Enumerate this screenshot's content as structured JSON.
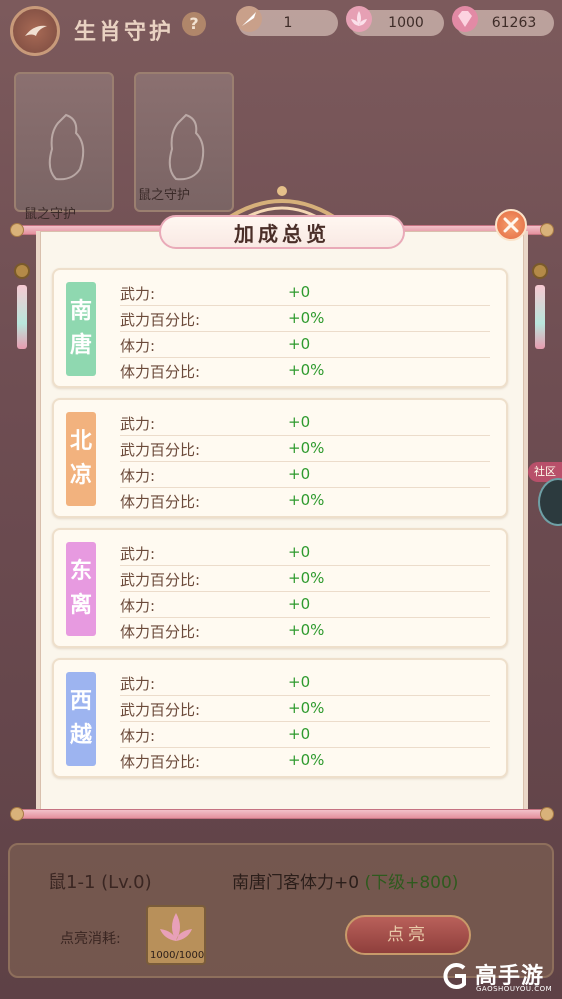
{
  "header": {
    "title": "生肖守护",
    "help_glyph": "?"
  },
  "resources": [
    {
      "icon": "quill-icon",
      "value": "1"
    },
    {
      "icon": "lotus-icon",
      "value": "1000"
    },
    {
      "icon": "gem-icon",
      "value": "61263"
    }
  ],
  "background_cards": {
    "card1_label": "鼠之守护",
    "card2_label": "鼠之守护"
  },
  "modal": {
    "title": "加成总览",
    "factions": [
      {
        "name_char1": "南",
        "name_char2": "唐",
        "color": "#8fd8b0",
        "stats": [
          {
            "label": "武力:",
            "value": "+0"
          },
          {
            "label": "武力百分比:",
            "value": "+0%"
          },
          {
            "label": "体力:",
            "value": "+0"
          },
          {
            "label": "体力百分比:",
            "value": "+0%"
          }
        ]
      },
      {
        "name_char1": "北",
        "name_char2": "凉",
        "color": "#f2b27e",
        "stats": [
          {
            "label": "武力:",
            "value": "+0"
          },
          {
            "label": "武力百分比:",
            "value": "+0%"
          },
          {
            "label": "体力:",
            "value": "+0"
          },
          {
            "label": "体力百分比:",
            "value": "+0%"
          }
        ]
      },
      {
        "name_char1": "东",
        "name_char2": "离",
        "color": "#e79ae0",
        "stats": [
          {
            "label": "武力:",
            "value": "+0"
          },
          {
            "label": "武力百分比:",
            "value": "+0%"
          },
          {
            "label": "体力:",
            "value": "+0"
          },
          {
            "label": "体力百分比:",
            "value": "+0%"
          }
        ]
      },
      {
        "name_char1": "西",
        "name_char2": "越",
        "color": "#9db4f0",
        "stats": [
          {
            "label": "武力:",
            "value": "+0"
          },
          {
            "label": "武力百分比:",
            "value": "+0%"
          },
          {
            "label": "体力:",
            "value": "+0"
          },
          {
            "label": "体力百分比:",
            "value": "+0%"
          }
        ]
      }
    ]
  },
  "bottom": {
    "node_name": "鼠1-1 (Lv.0)",
    "desc_prefix": "南唐门客体力+0 ",
    "desc_next": "(下级+800)",
    "cost_label": "点亮消耗:",
    "cost_count": "1000/1000",
    "light_button": "点亮"
  },
  "side_tab": "社区",
  "watermark": {
    "name": "高手游",
    "url": "GAOSHOUYOU.COM"
  },
  "colors": {
    "stat_value": "#2e9a2e",
    "accent_pink": "#e4919e",
    "close": "#e36a42"
  }
}
